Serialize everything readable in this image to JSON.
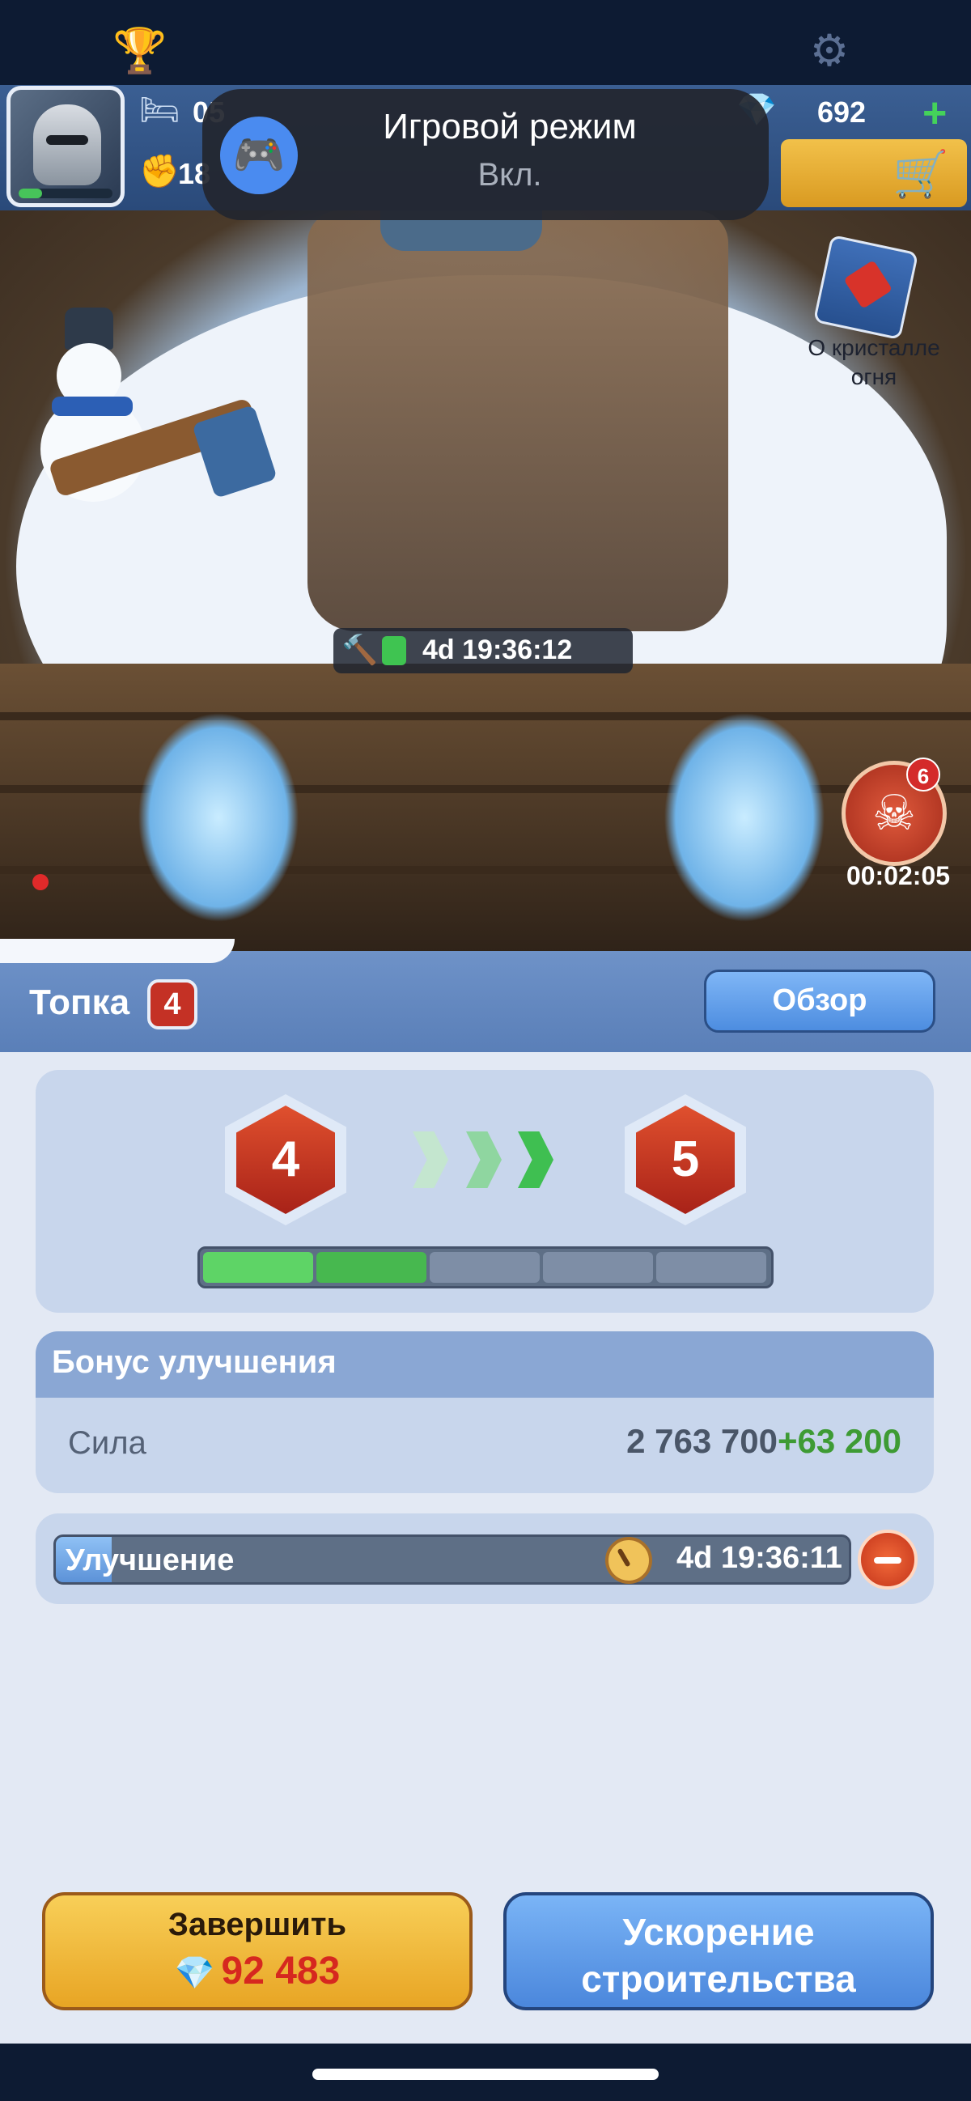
{
  "status_bar": {
    "trophy_icon": "trophy-icon",
    "settings_icon": "gear-icon"
  },
  "resources": {
    "sleep_value": "05",
    "power_value": "18",
    "gems": "692",
    "plus": "+"
  },
  "toast": {
    "title": "Игровой режим",
    "subtitle": "Вкл."
  },
  "scene": {
    "build_timer": "4d 19:36:12",
    "crystal_label": "О кристалле огня",
    "raid_count": "6",
    "raid_timer": "00:02:05"
  },
  "panel": {
    "title": "Топка",
    "level": "4",
    "overview_button": "Обзор"
  },
  "level_card": {
    "from_level": "4",
    "to_level": "5",
    "progress_segments_filled": 2,
    "progress_segments_total": 5
  },
  "bonus": {
    "title": "Бонус улучшения",
    "stat_label": "Сила",
    "stat_base": "2 763 700",
    "stat_add": "+63 200"
  },
  "upgrade": {
    "label": "Улучшение",
    "time_left": "4d 19:36:11",
    "progress_fraction": 0.07
  },
  "actions": {
    "finish_label": "Завершить",
    "finish_cost": "92 483",
    "speedup_line1": "Ускорение",
    "speedup_line2": "строительства"
  },
  "colors": {
    "accent_blue": "#4d8de0",
    "finish_yellow": "#f8cf58",
    "progress_green": "#3fc451",
    "bonus_green": "#3e9b34",
    "cost_red": "#d6281f"
  }
}
